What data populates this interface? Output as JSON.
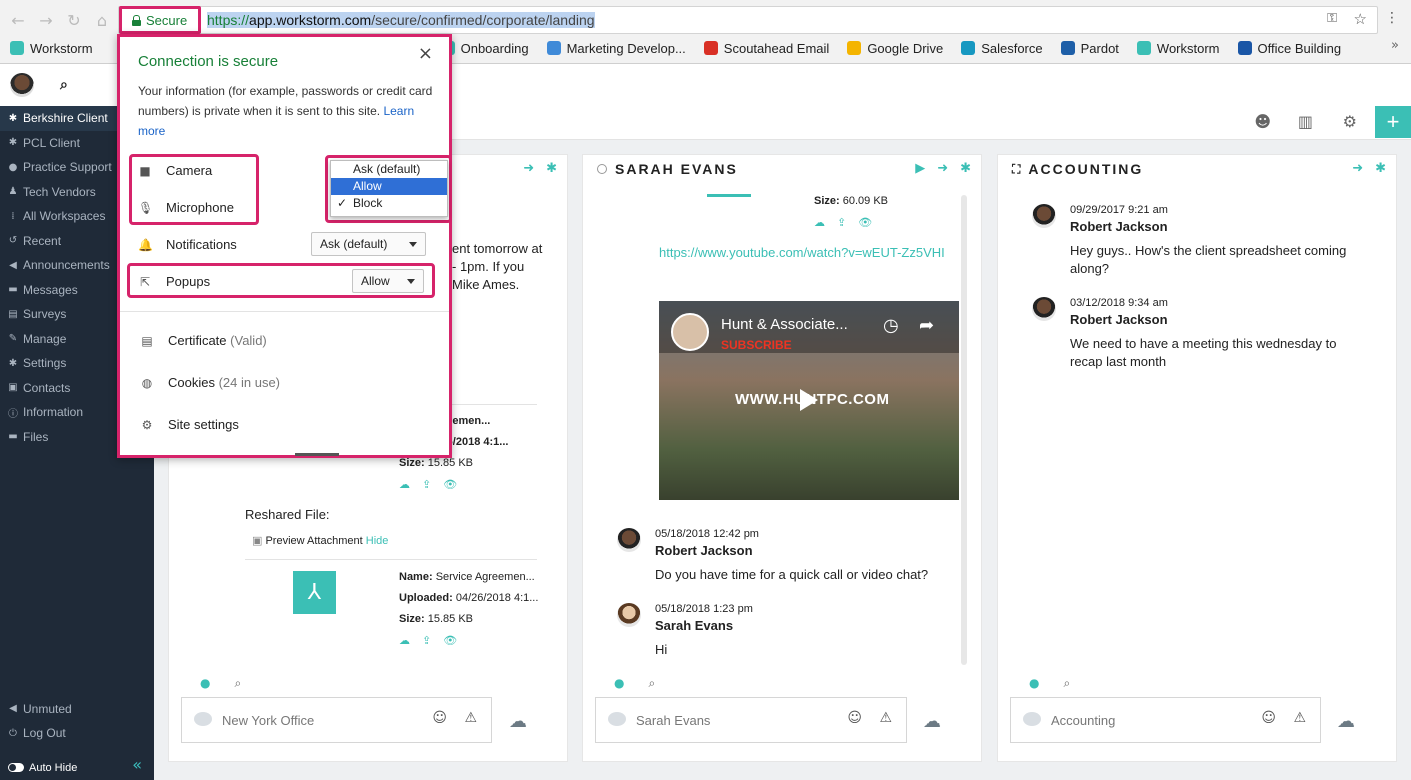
{
  "browser": {
    "secure_label": "Secure",
    "url_scheme": "https://",
    "url_host": "app.workstorm.com",
    "url_path": "/secure/confirmed/corporate/landing",
    "bookmarks": [
      {
        "label": "Workstorm",
        "color": "#3bbfb5"
      },
      {
        "label": "Onboarding",
        "color": "#3bbfb5"
      },
      {
        "label": "Marketing Develop...",
        "color": "#3f8ad8"
      },
      {
        "label": "Scoutahead Email",
        "color": "#d93025"
      },
      {
        "label": "Google Drive",
        "color": "#f4b400"
      },
      {
        "label": "Salesforce",
        "color": "#1798c1"
      },
      {
        "label": "Pardot",
        "color": "#1e5fa8"
      },
      {
        "label": "Workstorm",
        "color": "#3bbfb5"
      },
      {
        "label": "Office Building",
        "color": "#1a56a6"
      }
    ]
  },
  "site_info": {
    "title": "Connection is secure",
    "description": "Your information (for example, passwords or credit card numbers) is private when it is sent to this site.",
    "learn_more": "Learn more",
    "camera_label": "Camera",
    "microphone_label": "Microphone",
    "notifications_label": "Notifications",
    "notifications_value": "Ask (default)",
    "popups_label": "Popups",
    "popups_value": "Allow",
    "dropdown_options": [
      "Ask (default)",
      "Allow",
      "Block"
    ],
    "certificate_label": "Certificate",
    "certificate_status": "(Valid)",
    "cookies_label": "Cookies",
    "cookies_status": "(24 in use)",
    "site_settings_label": "Site settings"
  },
  "sidebar": {
    "items": [
      {
        "label": "Berkshire Client",
        "icon": "gear-icon"
      },
      {
        "label": "PCL Client",
        "icon": "gear-icon"
      },
      {
        "label": "Practice Support",
        "icon": "globe-icon"
      },
      {
        "label": "Tech Vendors",
        "icon": "person-icon"
      },
      {
        "label": "All Workspaces",
        "icon": "grid-icon"
      },
      {
        "label": "Recent",
        "icon": "history-icon"
      },
      {
        "label": "Announcements",
        "icon": "megaphone-icon"
      },
      {
        "label": "Messages",
        "icon": "chat-icon"
      },
      {
        "label": "Surveys",
        "icon": "clipboard-icon"
      },
      {
        "label": "Manage",
        "icon": "pencil-icon"
      },
      {
        "label": "Settings",
        "icon": "gear-icon"
      },
      {
        "label": "Contacts",
        "icon": "contact-icon"
      },
      {
        "label": "Information",
        "icon": "info-icon"
      },
      {
        "label": "Files",
        "icon": "folder-icon"
      }
    ],
    "unmuted_label": "Unmuted",
    "logout_label": "Log Out",
    "autohide_label": "Auto Hide"
  },
  "panel1": {
    "partial_line1": "ent tomorrow at",
    "partial_line2": "- 1pm.  If you",
    "partial_line3": "Mike Ames.",
    "file1_name_partial": "rvice Agreemen...",
    "file1_uploaded_partial": "oad: 04/26/2018 4:1...",
    "file1_size_label": "Size:",
    "file1_size": "15.85 KB",
    "reshared_label": "Reshared File:",
    "preview_label": "Preview Attachment",
    "hide_label": "Hide",
    "file2_name_label": "Name:",
    "file2_name": "Service Agreemen...",
    "file2_uploaded_label": "Uploaded:",
    "file2_uploaded": "04/26/2018 4:1...",
    "file2_size_label": "Size:",
    "file2_size": "15.85 KB",
    "composer_placeholder": "New York Office"
  },
  "panel2": {
    "title": "SARAH EVANS",
    "size_label": "Size:",
    "size_value": "60.09 KB",
    "youtube_link": "https://www.youtube.com/watch?v=wEUT-Zz5VHI",
    "video_title": "Hunt & Associate...",
    "video_subscribe": "SUBSCRIBE",
    "video_watermark": "WWW.HUNTPC.COM",
    "messages": [
      {
        "time": "05/18/2018 12:42 pm",
        "author": "Robert Jackson",
        "text": "Do you have time for a quick call or video chat?"
      },
      {
        "time": "05/18/2018 1:23 pm",
        "author": "Sarah Evans",
        "text": "Hi"
      }
    ],
    "composer_placeholder": "Sarah Evans"
  },
  "panel3": {
    "title": "ACCOUNTING",
    "messages": [
      {
        "time": "09/29/2017 9:21 am",
        "author": "Robert Jackson",
        "text": "Hey guys.. How's the client spreadsheet coming along?"
      },
      {
        "time": "03/12/2018 9:34 am",
        "author": "Robert Jackson",
        "text": "We need to have a meeting this wednesday to recap last month"
      }
    ],
    "composer_placeholder": "Accounting"
  },
  "colors": {
    "accent": "#3bbfb5",
    "highlight": "#d6236a",
    "sidebar": "#1f2a38"
  }
}
